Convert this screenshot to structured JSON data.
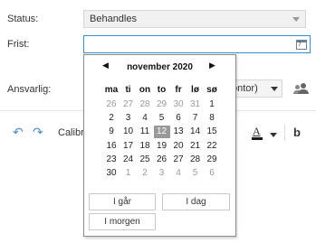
{
  "form": {
    "status_label": "Status:",
    "status_value": "Behandles",
    "frist_label": "Frist:",
    "frist_value": "",
    "ansvarlig_label": "Ansvarlig:",
    "ansvarlig_value": "ontor)"
  },
  "toolbar": {
    "font_name": "Calibri",
    "bold_label": "b",
    "color_letter": "A"
  },
  "calendar": {
    "month_title": "november 2020",
    "prev_label": "◀",
    "next_label": "▶",
    "weekdays": [
      "ma",
      "ti",
      "on",
      "to",
      "fr",
      "lø",
      "sø"
    ],
    "weeks": [
      [
        "26",
        "27",
        "28",
        "29",
        "30",
        "31",
        "1"
      ],
      [
        "2",
        "3",
        "4",
        "5",
        "6",
        "7",
        "8"
      ],
      [
        "9",
        "10",
        "11",
        "12",
        "13",
        "14",
        "15"
      ],
      [
        "16",
        "17",
        "18",
        "19",
        "20",
        "21",
        "22"
      ],
      [
        "23",
        "24",
        "25",
        "26",
        "27",
        "28",
        "29"
      ],
      [
        "30",
        "1",
        "2",
        "3",
        "4",
        "5",
        "6"
      ]
    ],
    "selected_day": "12",
    "quick_buttons": {
      "yesterday": "I går",
      "today": "I dag",
      "tomorrow": "I morgen"
    }
  },
  "colors": {
    "accent": "#3c8ad0",
    "selected_day_bg": "#999999",
    "muted_text": "#9a9a9a"
  }
}
